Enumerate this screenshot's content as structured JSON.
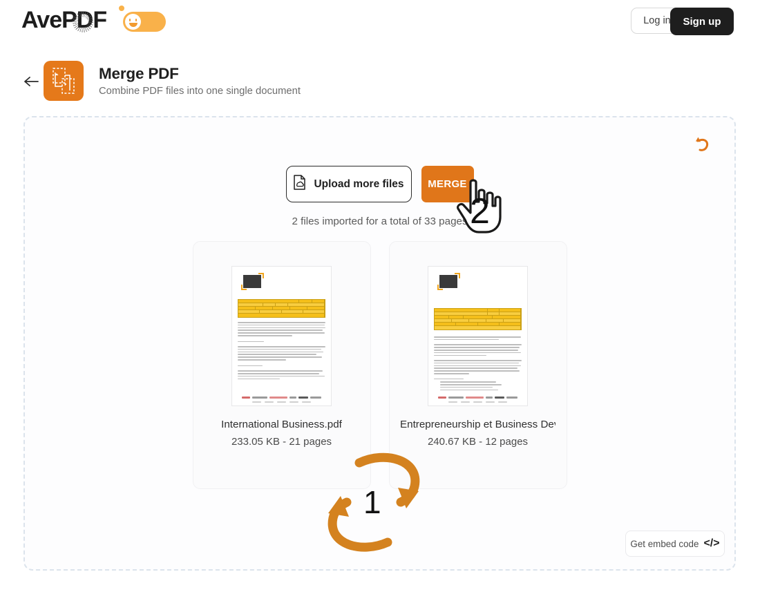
{
  "header": {
    "logo_text": "AvePDF",
    "logo_globe_icon": "globe-icon",
    "theme_toggle_icon": "smiley-face-icon",
    "login_label": "Log in",
    "signup_label": "Sign up"
  },
  "page": {
    "back_icon": "arrow-left-icon",
    "tool_icon": "merge-pdf-icon",
    "title": "Merge PDF",
    "subtitle": "Combine PDF files into one single document"
  },
  "panel": {
    "reset_icon": "undo-arrow-icon",
    "upload_label": "Upload more files",
    "upload_icon": "document-cloud-icon",
    "merge_label": "MERGE",
    "import_info": "2 files imported for a total of 33 pages",
    "embed_label": "Get embed code",
    "embed_icon": "code-brackets-icon"
  },
  "files": [
    {
      "name": "International Business.pdf",
      "meta": "233.05 KB - 21 pages"
    },
    {
      "name": "Entrepreneurship et Business Dev...",
      "meta": "240.67 KB - 12 pages"
    }
  ],
  "annotations": [
    {
      "id": "swap-files",
      "number": "1",
      "icon": "swap-arrows-icon"
    },
    {
      "id": "click-merge",
      "number": "2",
      "icon": "hand-pointer-icon"
    }
  ],
  "colors": {
    "accent_orange": "#e0761a",
    "toggle_orange": "#f9b14a",
    "dark": "#1e1e1e"
  }
}
